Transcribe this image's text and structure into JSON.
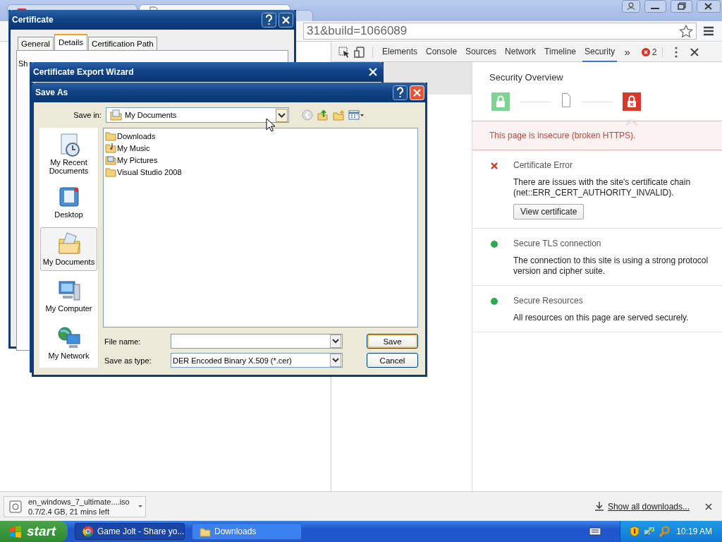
{
  "browser": {
    "tabs": [
      {
        "selected": false
      },
      {
        "selected": true
      }
    ],
    "address": "31&build=1066089"
  },
  "devtools": {
    "tabs": [
      {
        "label": "Elements",
        "selected": false
      },
      {
        "label": "Console",
        "selected": false
      },
      {
        "label": "Sources",
        "selected": false
      },
      {
        "label": "Network",
        "selected": false
      },
      {
        "label": "Timeline",
        "selected": false
      },
      {
        "label": "Security",
        "selected": true
      }
    ],
    "overflow": "»",
    "error_count": "2",
    "sidebar_items": [
      {
        "selected": true
      }
    ]
  },
  "security": {
    "title": "Security Overview",
    "steps": [
      {
        "kind": "secure",
        "selected": false
      },
      {
        "kind": "neutral",
        "selected": false
      },
      {
        "kind": "insecure",
        "selected": true
      }
    ],
    "summary": "This page is insecure (broken HTTPS).",
    "items": [
      {
        "kind": "error",
        "title": "Certificate Error",
        "text": "There are issues with the site's certificate chain (net::ERR_CERT_AUTHORITY_INVALID).",
        "button": "View certificate"
      },
      {
        "kind": "secure",
        "title": "Secure TLS connection",
        "text": "The connection to this site is using a strong protocol version and cipher suite."
      },
      {
        "kind": "secure",
        "title": "Secure Resources",
        "text": "All resources on this page are served securely."
      }
    ]
  },
  "certificate_dialog": {
    "title": "Certificate",
    "tabs": [
      {
        "label": "General",
        "selected": false
      },
      {
        "label": "Details",
        "selected": true
      },
      {
        "label": "Certification Path",
        "selected": false
      }
    ],
    "field_label_fragment": "Sh"
  },
  "export_wizard": {
    "title": "Certificate Export Wizard"
  },
  "save_as": {
    "title": "Save As",
    "save_in_label": "Save in:",
    "save_in_value": "My Documents",
    "places": [
      {
        "kind": "recent",
        "label": "My Recent Documents",
        "selected": false
      },
      {
        "kind": "desktop",
        "label": "Desktop",
        "selected": false
      },
      {
        "kind": "documents",
        "label": "My Documents",
        "selected": true
      },
      {
        "kind": "computer",
        "label": "My Computer",
        "selected": false
      },
      {
        "kind": "network",
        "label": "My Network",
        "selected": false
      }
    ],
    "files": [
      {
        "kind": "folder",
        "name": "Downloads"
      },
      {
        "kind": "music",
        "name": "My Music"
      },
      {
        "kind": "pictures",
        "name": "My Pictures"
      },
      {
        "kind": "folder",
        "name": "Visual Studio 2008"
      }
    ],
    "file_name_label": "File name:",
    "type_label": "Save as type:",
    "type_value": "DER Encoded Binary X.509 (*.cer)",
    "buttons": [
      {
        "label": "Save",
        "default": true
      },
      {
        "label": "Cancel",
        "default": false
      }
    ]
  },
  "download_bar": {
    "file": "en_windows_7_ultimate....iso",
    "progress": "0.7/2.4 GB, 21 mins left",
    "show_all": "Show all downloads..."
  },
  "taskbar": {
    "start": "start",
    "windows": [
      {
        "kind": "browser",
        "label": "Game Jolt - Share yo...",
        "selected": true
      },
      {
        "kind": "folder",
        "label": "Downloads",
        "selected": false
      }
    ],
    "clock": "10:19 AM"
  }
}
